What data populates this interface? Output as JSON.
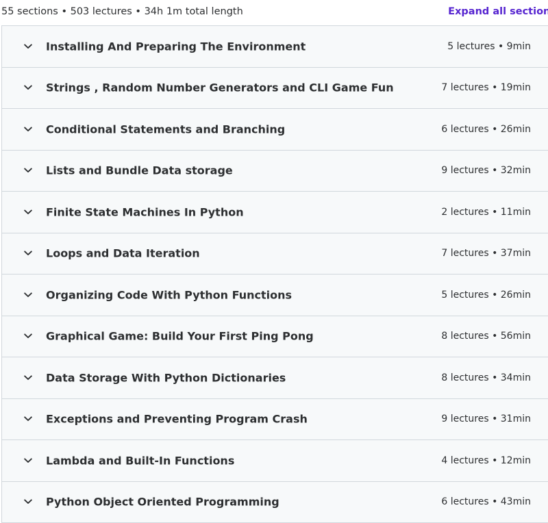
{
  "summary": {
    "text": "55 sections • 503 lectures • 34h 1m total length",
    "expand_label": "Expand all sections"
  },
  "icons": {
    "section_toggle": "chevron-down-icon"
  },
  "colors": {
    "link": "#5624d0",
    "section_bg": "#f7f9fa",
    "border": "#d1d7dc",
    "text": "#2d2f31"
  },
  "sections": [
    {
      "title": "Installing And Preparing The Environment",
      "meta": "5 lectures • 9min"
    },
    {
      "title": "Strings , Random Number Generators and CLI Game Fun",
      "meta": "7 lectures • 19min"
    },
    {
      "title": "Conditional Statements and Branching",
      "meta": "6 lectures • 26min"
    },
    {
      "title": "Lists and Bundle Data storage",
      "meta": "9 lectures • 32min"
    },
    {
      "title": "Finite State Machines In Python",
      "meta": "2 lectures • 11min"
    },
    {
      "title": "Loops and Data Iteration",
      "meta": "7 lectures • 37min"
    },
    {
      "title": "Organizing Code With Python Functions",
      "meta": "5 lectures • 26min"
    },
    {
      "title": "Graphical Game: Build Your First Ping Pong",
      "meta": "8 lectures • 56min"
    },
    {
      "title": "Data Storage With Python Dictionaries",
      "meta": "8 lectures • 34min"
    },
    {
      "title": "Exceptions and Preventing Program Crash",
      "meta": "9 lectures • 31min"
    },
    {
      "title": "Lambda and Built-In Functions",
      "meta": "4 lectures • 12min"
    },
    {
      "title": "Python Object Oriented Programming",
      "meta": "6 lectures • 43min"
    }
  ]
}
